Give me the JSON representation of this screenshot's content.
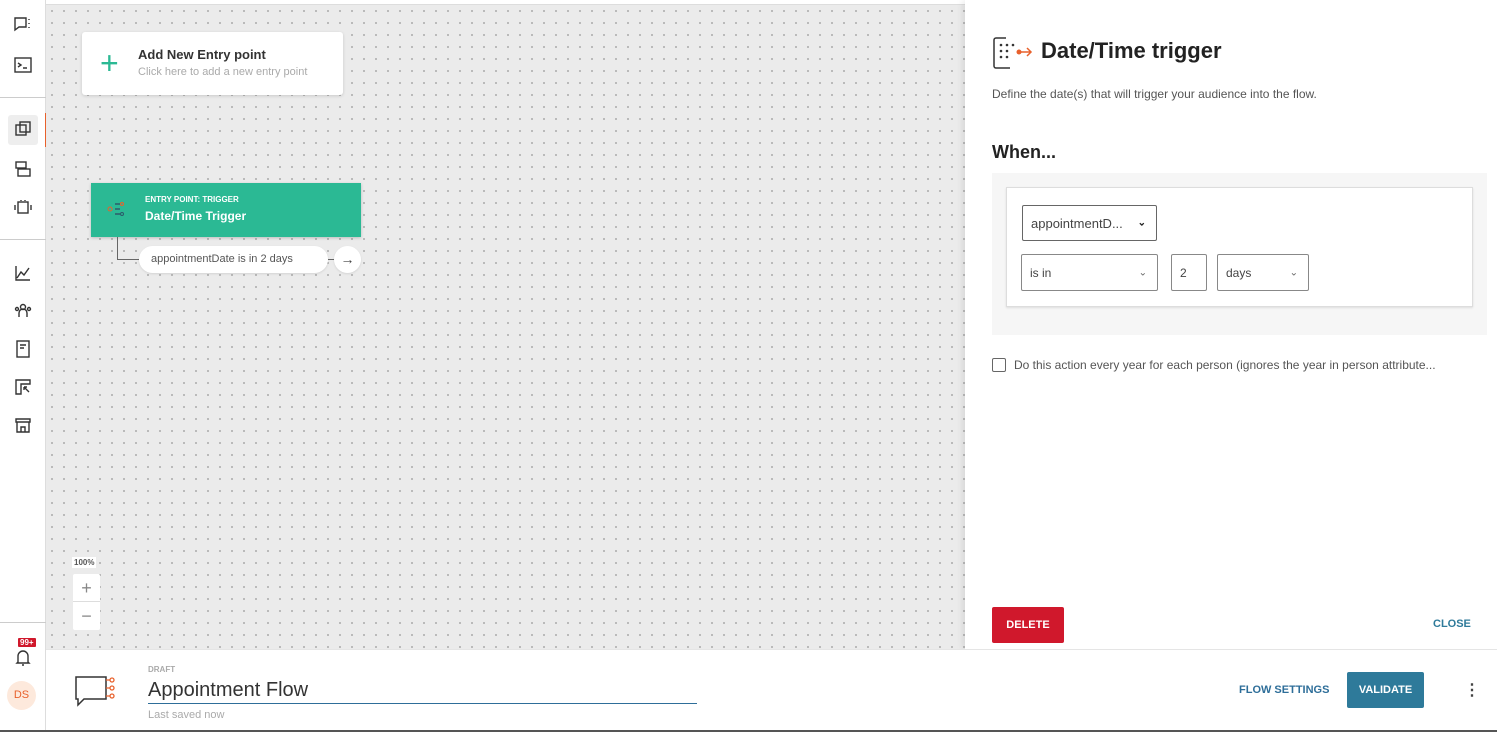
{
  "sidebar": {
    "icons": [
      "chat-menu-icon",
      "terminal-icon",
      "flows-icon",
      "templates-icon",
      "bot-icon",
      "analytics-icon",
      "audience-icon",
      "catalog-icon",
      "campaign-icon",
      "store-icon"
    ],
    "notifications_badge": "99+",
    "avatar_initials": "DS"
  },
  "canvas": {
    "add_entry": {
      "title": "Add New Entry point",
      "subtitle": "Click here to add a new entry point"
    },
    "trigger_node": {
      "kicker": "ENTRY POINT: TRIGGER",
      "name": "Date/Time Trigger"
    },
    "condition": "appointmentDate is in 2 days",
    "zoom_level": "100%",
    "zoom_in": "+",
    "zoom_out": "−"
  },
  "panel": {
    "title": "Date/Time trigger",
    "description": "Define the date(s) that will trigger your audience into the flow.",
    "when_label": "When...",
    "attribute": "appointmentD...",
    "operator": "is in",
    "amount": "2",
    "unit": "days",
    "yearly_checkbox": "Do this action every year for each person (ignores the year in person attribute...",
    "yearly_checked": false,
    "delete_label": "DELETE",
    "close_label": "CLOSE",
    "colors": {
      "accent": "#2bb994",
      "danger": "#d0182c",
      "primary": "#2e7a9a",
      "orange": "#e8612c"
    }
  },
  "footer": {
    "status": "DRAFT",
    "flow_name": "Appointment Flow",
    "saved": "Last saved now",
    "flow_settings": "FLOW SETTINGS",
    "validate": "VALIDATE",
    "more": "⋮"
  }
}
